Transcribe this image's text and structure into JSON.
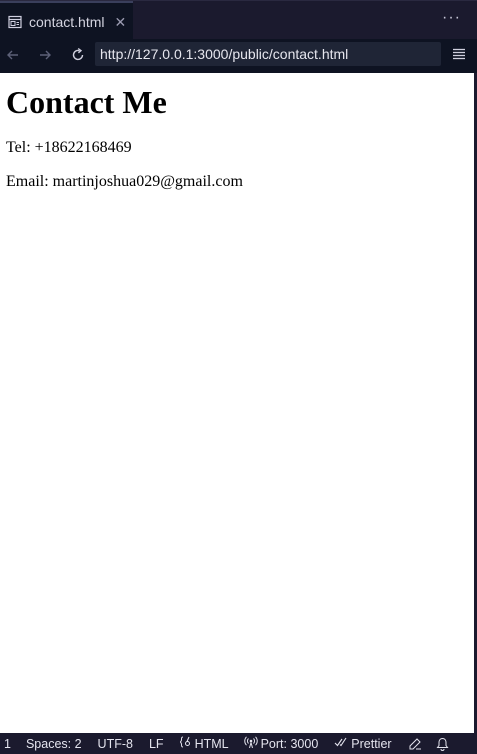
{
  "tab": {
    "title": "contact.html",
    "icon": "preview-icon",
    "close_glyph": "✕"
  },
  "more_glyph": "···",
  "nav": {
    "url": "http://127.0.0.1:3000/public/contact.html"
  },
  "page": {
    "heading": "Contact Me",
    "tel": "Tel: +18622168469",
    "email": "Email: martinjoshua029@gmail.com"
  },
  "status": {
    "line": "1",
    "spaces": "Spaces: 2",
    "encoding": "UTF-8",
    "eol": "LF",
    "language": "HTML",
    "port": "Port: 3000",
    "prettier": "Prettier"
  },
  "colors": {
    "chrome_bg": "#1b1a2e",
    "nav_bg": "#0e1322",
    "url_bg": "#1f2536"
  }
}
